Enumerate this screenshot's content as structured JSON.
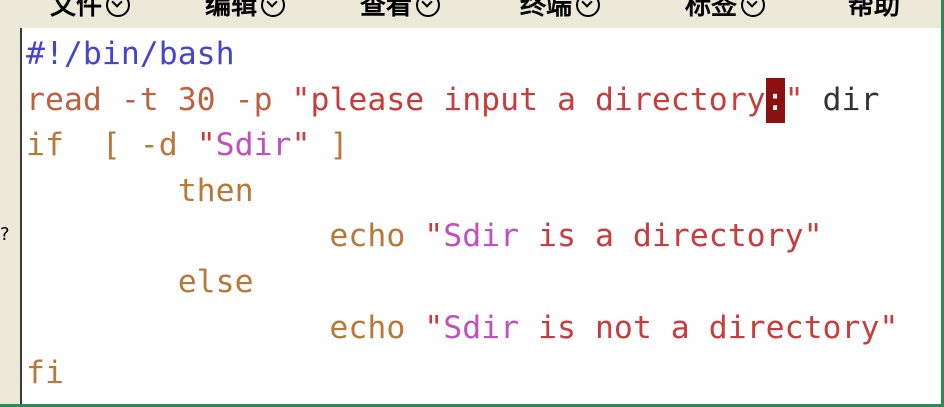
{
  "menubar": {
    "items": [
      "文件",
      "编辑",
      "查看",
      "终端",
      "标签",
      "帮助"
    ]
  },
  "left_strip": {
    "marks": [
      "?"
    ]
  },
  "editor": {
    "lines": [
      [
        {
          "t": "#!/bin/bash",
          "c": "shebang"
        }
      ],
      [
        {
          "t": "read -t 30 -p ",
          "c": "cmd"
        },
        {
          "t": "\"please input a directory",
          "c": "str"
        },
        {
          "t": ":",
          "c": "cursor"
        },
        {
          "t": "\"",
          "c": "str"
        },
        {
          "t": " dir",
          "c": "plain"
        }
      ],
      [
        {
          "t": "if  [ -d ",
          "c": "kw"
        },
        {
          "t": "\"",
          "c": "str"
        },
        {
          "t": "Sdir",
          "c": "var"
        },
        {
          "t": "\"",
          "c": "str"
        },
        {
          "t": " ]",
          "c": "kw"
        }
      ],
      [
        {
          "t": "        then",
          "c": "kw"
        }
      ],
      [
        {
          "t": "                echo ",
          "c": "kw"
        },
        {
          "t": "\"",
          "c": "str"
        },
        {
          "t": "Sdir",
          "c": "var"
        },
        {
          "t": " is a directory\"",
          "c": "str"
        }
      ],
      [
        {
          "t": "        else",
          "c": "kw"
        }
      ],
      [
        {
          "t": "                echo ",
          "c": "kw"
        },
        {
          "t": "\"",
          "c": "str"
        },
        {
          "t": "Sdir",
          "c": "var"
        },
        {
          "t": " is not a directory\"",
          "c": "str"
        }
      ],
      [
        {
          "t": "fi",
          "c": "kw"
        }
      ]
    ]
  },
  "colors": {
    "shebang": "#4444cc",
    "command": "#c06040",
    "string": "#c83c3c",
    "variable": "#c050c0",
    "keyword": "#b8783a",
    "cursor": "#8b1010",
    "window_border": "#2d8a57"
  }
}
